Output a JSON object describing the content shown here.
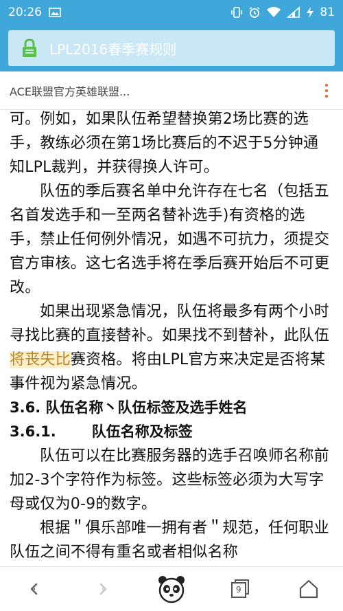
{
  "status_bar": {
    "time": "20:26",
    "battery": "81",
    "icons": [
      "image-icon",
      "vibrate-icon",
      "alarm-icon",
      "wifi-icon",
      "signal-icon",
      "charging-icon"
    ]
  },
  "browser": {
    "page_title": "LPL2016春季赛规则",
    "lock_icon": "lock-icon",
    "accent_color": "#3fa7d9",
    "lock_color": "#5cc04a"
  },
  "site_header": {
    "name": "ACE联盟官方英雄联盟...",
    "menu_icon": "more-vertical-icon"
  },
  "article": {
    "p1_before": "可。例如，如果队伍希望替换第2场比赛的选手，教练必须在第1场比赛后的不迟于5分钟通知LPL裁判，并获得换人许可。",
    "p2": "队伍的季后赛名单中允许存在七名（包括五名首发选手和一至两名替补选手)有资格的选手，禁止任何例外情况，如遇不可抗力，须提交官方审核。这七名选手将在季后赛开始后不可更改。",
    "p3_a": "如果出现紧急情况，队伍将最多有两个小时寻找比赛的直接替补。如果找不到替补，此队伍",
    "p3_hl": "将丧失比",
    "p3_b": "赛资格。将由LPL官方来决定是否将某事件视为紧急情况。",
    "h1": "3.6. 队伍名称丶队伍标签及选手姓名",
    "h2_num": "3.6.1.",
    "h2_text": "队伍名称及标签",
    "p4": "队伍可以在比赛服务器的选手召唤师名称前加2-3个字符作为标签。这些标签必须为大写字母或仅为0-9的数字。",
    "p5": "根据＂俱乐部唯一拥有者＂规范，任何职业队伍之间不得有重名或者相似名称"
  },
  "bottom_nav": {
    "back_icon": "chevron-left-icon",
    "forward_icon": "chevron-right-icon",
    "home_logo": "panda-logo-icon",
    "tabs_count": "9",
    "tabs_icon": "tabs-icon",
    "home_icon": "home-icon"
  }
}
